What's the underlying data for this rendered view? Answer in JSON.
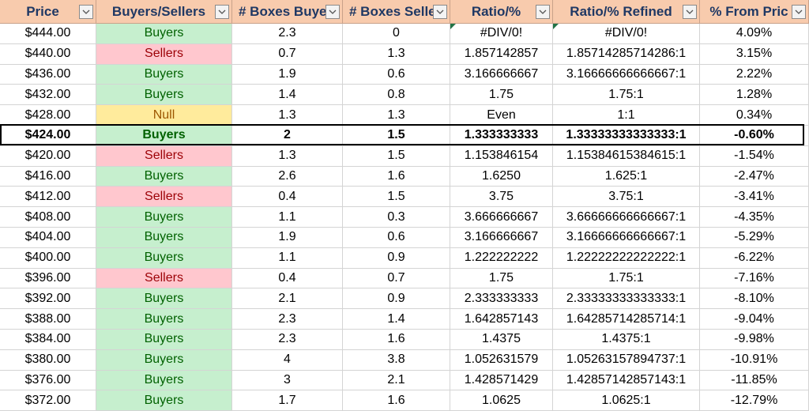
{
  "headers": [
    "Price",
    "Buyers/Sellers",
    "# Boxes Buye",
    "# Boxes Selle",
    "Ratio/%",
    "Ratio/% Refined",
    "% From Pric"
  ],
  "status_colors": {
    "buyers_fill": "#c6efce",
    "buyers_text": "#006100",
    "sellers_fill": "#ffc7ce",
    "sellers_text": "#9c0006",
    "null_fill": "#ffeb9c",
    "null_text": "#9c5700",
    "header_fill": "#f8cbad"
  },
  "rows": [
    {
      "price": "$444.00",
      "side": "Buyers",
      "buy": "2.3",
      "sell": "0",
      "ratio": "#DIV/0!",
      "refined": "#DIV/0!",
      "pct": "4.09%"
    },
    {
      "price": "$440.00",
      "side": "Sellers",
      "buy": "0.7",
      "sell": "1.3",
      "ratio": "1.857142857",
      "refined": "1.85714285714286:1",
      "pct": "3.15%"
    },
    {
      "price": "$436.00",
      "side": "Buyers",
      "buy": "1.9",
      "sell": "0.6",
      "ratio": "3.166666667",
      "refined": "3.16666666666667:1",
      "pct": "2.22%"
    },
    {
      "price": "$432.00",
      "side": "Buyers",
      "buy": "1.4",
      "sell": "0.8",
      "ratio": "1.75",
      "refined": "1.75:1",
      "pct": "1.28%"
    },
    {
      "price": "$428.00",
      "side": "Null",
      "buy": "1.3",
      "sell": "1.3",
      "ratio": "Even",
      "refined": "1:1",
      "pct": "0.34%"
    },
    {
      "price": "$424.00",
      "side": "Buyers",
      "buy": "2",
      "sell": "1.5",
      "ratio": "1.333333333",
      "refined": "1.33333333333333:1",
      "pct": "-0.60%"
    },
    {
      "price": "$420.00",
      "side": "Sellers",
      "buy": "1.3",
      "sell": "1.5",
      "ratio": "1.153846154",
      "refined": "1.15384615384615:1",
      "pct": "-1.54%"
    },
    {
      "price": "$416.00",
      "side": "Buyers",
      "buy": "2.6",
      "sell": "1.6",
      "ratio": "1.6250",
      "refined": "1.625:1",
      "pct": "-2.47%"
    },
    {
      "price": "$412.00",
      "side": "Sellers",
      "buy": "0.4",
      "sell": "1.5",
      "ratio": "3.75",
      "refined": "3.75:1",
      "pct": "-3.41%"
    },
    {
      "price": "$408.00",
      "side": "Buyers",
      "buy": "1.1",
      "sell": "0.3",
      "ratio": "3.666666667",
      "refined": "3.66666666666667:1",
      "pct": "-4.35%"
    },
    {
      "price": "$404.00",
      "side": "Buyers",
      "buy": "1.9",
      "sell": "0.6",
      "ratio": "3.166666667",
      "refined": "3.16666666666667:1",
      "pct": "-5.29%"
    },
    {
      "price": "$400.00",
      "side": "Buyers",
      "buy": "1.1",
      "sell": "0.9",
      "ratio": "1.222222222",
      "refined": "1.22222222222222:1",
      "pct": "-6.22%"
    },
    {
      "price": "$396.00",
      "side": "Sellers",
      "buy": "0.4",
      "sell": "0.7",
      "ratio": "1.75",
      "refined": "1.75:1",
      "pct": "-7.16%"
    },
    {
      "price": "$392.00",
      "side": "Buyers",
      "buy": "2.1",
      "sell": "0.9",
      "ratio": "2.333333333",
      "refined": "2.33333333333333:1",
      "pct": "-8.10%"
    },
    {
      "price": "$388.00",
      "side": "Buyers",
      "buy": "2.3",
      "sell": "1.4",
      "ratio": "1.642857143",
      "refined": "1.64285714285714:1",
      "pct": "-9.04%"
    },
    {
      "price": "$384.00",
      "side": "Buyers",
      "buy": "2.3",
      "sell": "1.6",
      "ratio": "1.4375",
      "refined": "1.4375:1",
      "pct": "-9.98%"
    },
    {
      "price": "$380.00",
      "side": "Buyers",
      "buy": "4",
      "sell": "3.8",
      "ratio": "1.052631579",
      "refined": "1.05263157894737:1",
      "pct": "-10.91%"
    },
    {
      "price": "$376.00",
      "side": "Buyers",
      "buy": "3",
      "sell": "2.1",
      "ratio": "1.428571429",
      "refined": "1.42857142857143:1",
      "pct": "-11.85%"
    },
    {
      "price": "$372.00",
      "side": "Buyers",
      "buy": "1.7",
      "sell": "1.6",
      "ratio": "1.0625",
      "refined": "1.0625:1",
      "pct": "-12.79%"
    }
  ]
}
